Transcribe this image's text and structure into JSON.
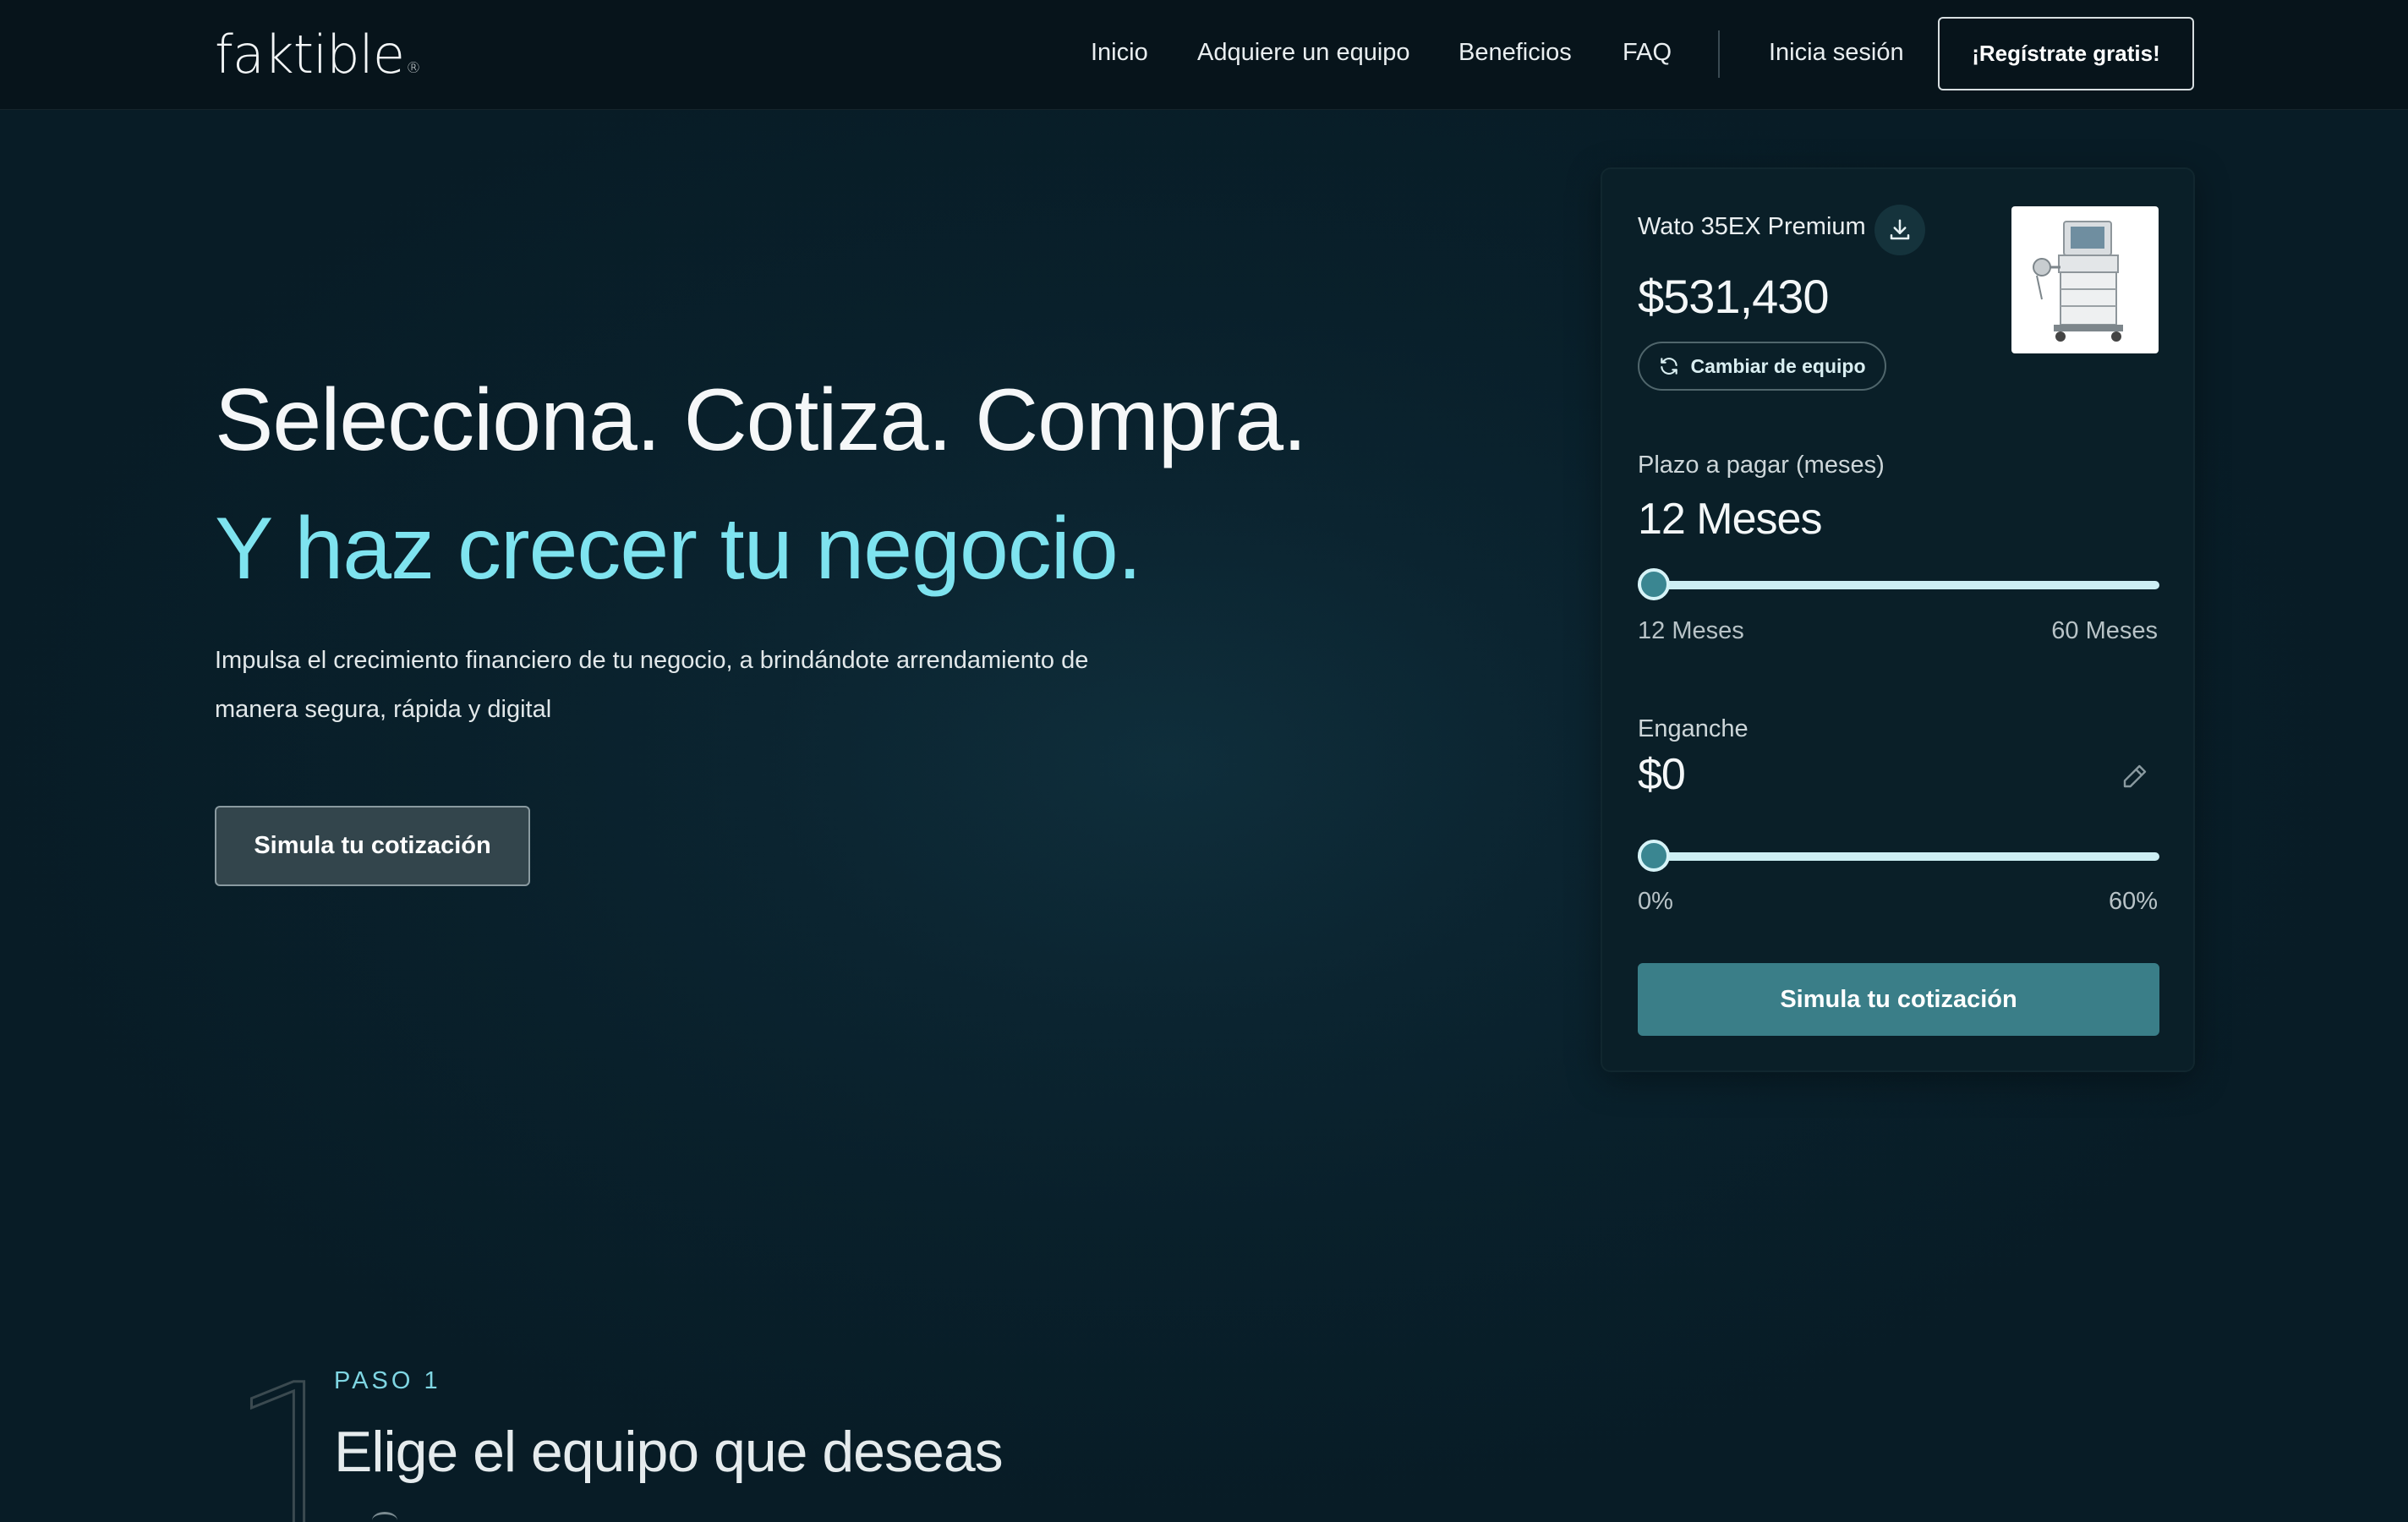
{
  "header": {
    "logo": "faktible",
    "logo_mark": "®",
    "nav": [
      "Inicio",
      "Adquiere un equipo",
      "Beneficios",
      "FAQ"
    ],
    "login": "Inicia sesión",
    "register": "¡Regístrate gratis!"
  },
  "hero": {
    "title": "Selecciona. Cotiza. Compra.",
    "subtitle": "Y haz crecer tu negocio.",
    "description": "Impulsa el crecimiento financiero de tu negocio, a brindándote arrendamiento de manera segura, rápida y digital",
    "cta": "Simula tu cotización"
  },
  "card": {
    "product_name": "Wato 35EX Premium",
    "price": "$531,430",
    "change_label": "Cambiar de equipo",
    "term": {
      "label": "Plazo a pagar (meses)",
      "value": "12 Meses",
      "min": "12 Meses",
      "max": "60 Meses",
      "level": 0
    },
    "down_payment": {
      "label": "Enganche",
      "value": "$0",
      "min": "0%",
      "max": "60%",
      "level": 0
    },
    "cta": "Simula tu cotización"
  },
  "step": {
    "number": "1",
    "label": "PASO 1",
    "title": "Elige el equipo que deseas"
  },
  "icons": {
    "download": "download-icon",
    "refresh": "refresh-icon",
    "edit": "pencil-icon"
  },
  "colors": {
    "accent": "#7ee3ef",
    "button_primary": "#3a7e88",
    "background": "#0b2430"
  }
}
